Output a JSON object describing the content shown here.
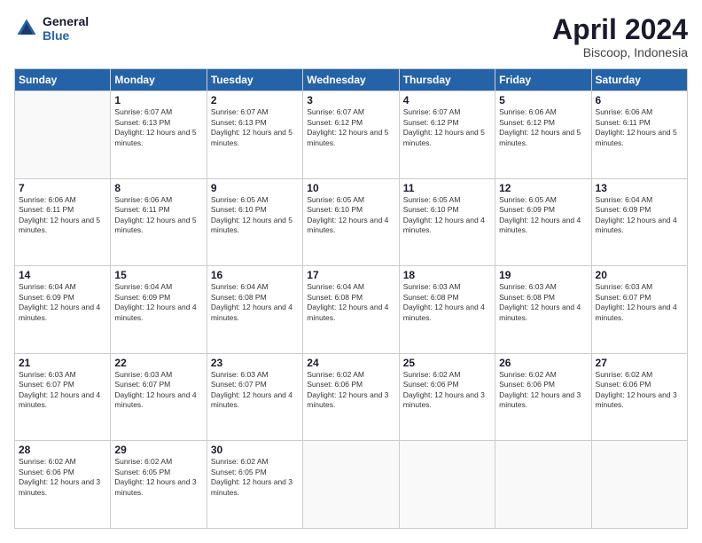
{
  "logo": {
    "line1": "General",
    "line2": "Blue"
  },
  "title": "April 2024",
  "subtitle": "Biscoop, Indonesia",
  "days_header": [
    "Sunday",
    "Monday",
    "Tuesday",
    "Wednesday",
    "Thursday",
    "Friday",
    "Saturday"
  ],
  "weeks": [
    [
      {
        "day": "",
        "sunrise": "",
        "sunset": "",
        "daylight": ""
      },
      {
        "day": "1",
        "sunrise": "Sunrise: 6:07 AM",
        "sunset": "Sunset: 6:13 PM",
        "daylight": "Daylight: 12 hours and 5 minutes."
      },
      {
        "day": "2",
        "sunrise": "Sunrise: 6:07 AM",
        "sunset": "Sunset: 6:13 PM",
        "daylight": "Daylight: 12 hours and 5 minutes."
      },
      {
        "day": "3",
        "sunrise": "Sunrise: 6:07 AM",
        "sunset": "Sunset: 6:12 PM",
        "daylight": "Daylight: 12 hours and 5 minutes."
      },
      {
        "day": "4",
        "sunrise": "Sunrise: 6:07 AM",
        "sunset": "Sunset: 6:12 PM",
        "daylight": "Daylight: 12 hours and 5 minutes."
      },
      {
        "day": "5",
        "sunrise": "Sunrise: 6:06 AM",
        "sunset": "Sunset: 6:12 PM",
        "daylight": "Daylight: 12 hours and 5 minutes."
      },
      {
        "day": "6",
        "sunrise": "Sunrise: 6:06 AM",
        "sunset": "Sunset: 6:11 PM",
        "daylight": "Daylight: 12 hours and 5 minutes."
      }
    ],
    [
      {
        "day": "7",
        "sunrise": "Sunrise: 6:06 AM",
        "sunset": "Sunset: 6:11 PM",
        "daylight": "Daylight: 12 hours and 5 minutes."
      },
      {
        "day": "8",
        "sunrise": "Sunrise: 6:06 AM",
        "sunset": "Sunset: 6:11 PM",
        "daylight": "Daylight: 12 hours and 5 minutes."
      },
      {
        "day": "9",
        "sunrise": "Sunrise: 6:05 AM",
        "sunset": "Sunset: 6:10 PM",
        "daylight": "Daylight: 12 hours and 5 minutes."
      },
      {
        "day": "10",
        "sunrise": "Sunrise: 6:05 AM",
        "sunset": "Sunset: 6:10 PM",
        "daylight": "Daylight: 12 hours and 4 minutes."
      },
      {
        "day": "11",
        "sunrise": "Sunrise: 6:05 AM",
        "sunset": "Sunset: 6:10 PM",
        "daylight": "Daylight: 12 hours and 4 minutes."
      },
      {
        "day": "12",
        "sunrise": "Sunrise: 6:05 AM",
        "sunset": "Sunset: 6:09 PM",
        "daylight": "Daylight: 12 hours and 4 minutes."
      },
      {
        "day": "13",
        "sunrise": "Sunrise: 6:04 AM",
        "sunset": "Sunset: 6:09 PM",
        "daylight": "Daylight: 12 hours and 4 minutes."
      }
    ],
    [
      {
        "day": "14",
        "sunrise": "Sunrise: 6:04 AM",
        "sunset": "Sunset: 6:09 PM",
        "daylight": "Daylight: 12 hours and 4 minutes."
      },
      {
        "day": "15",
        "sunrise": "Sunrise: 6:04 AM",
        "sunset": "Sunset: 6:09 PM",
        "daylight": "Daylight: 12 hours and 4 minutes."
      },
      {
        "day": "16",
        "sunrise": "Sunrise: 6:04 AM",
        "sunset": "Sunset: 6:08 PM",
        "daylight": "Daylight: 12 hours and 4 minutes."
      },
      {
        "day": "17",
        "sunrise": "Sunrise: 6:04 AM",
        "sunset": "Sunset: 6:08 PM",
        "daylight": "Daylight: 12 hours and 4 minutes."
      },
      {
        "day": "18",
        "sunrise": "Sunrise: 6:03 AM",
        "sunset": "Sunset: 6:08 PM",
        "daylight": "Daylight: 12 hours and 4 minutes."
      },
      {
        "day": "19",
        "sunrise": "Sunrise: 6:03 AM",
        "sunset": "Sunset: 6:08 PM",
        "daylight": "Daylight: 12 hours and 4 minutes."
      },
      {
        "day": "20",
        "sunrise": "Sunrise: 6:03 AM",
        "sunset": "Sunset: 6:07 PM",
        "daylight": "Daylight: 12 hours and 4 minutes."
      }
    ],
    [
      {
        "day": "21",
        "sunrise": "Sunrise: 6:03 AM",
        "sunset": "Sunset: 6:07 PM",
        "daylight": "Daylight: 12 hours and 4 minutes."
      },
      {
        "day": "22",
        "sunrise": "Sunrise: 6:03 AM",
        "sunset": "Sunset: 6:07 PM",
        "daylight": "Daylight: 12 hours and 4 minutes."
      },
      {
        "day": "23",
        "sunrise": "Sunrise: 6:03 AM",
        "sunset": "Sunset: 6:07 PM",
        "daylight": "Daylight: 12 hours and 4 minutes."
      },
      {
        "day": "24",
        "sunrise": "Sunrise: 6:02 AM",
        "sunset": "Sunset: 6:06 PM",
        "daylight": "Daylight: 12 hours and 3 minutes."
      },
      {
        "day": "25",
        "sunrise": "Sunrise: 6:02 AM",
        "sunset": "Sunset: 6:06 PM",
        "daylight": "Daylight: 12 hours and 3 minutes."
      },
      {
        "day": "26",
        "sunrise": "Sunrise: 6:02 AM",
        "sunset": "Sunset: 6:06 PM",
        "daylight": "Daylight: 12 hours and 3 minutes."
      },
      {
        "day": "27",
        "sunrise": "Sunrise: 6:02 AM",
        "sunset": "Sunset: 6:06 PM",
        "daylight": "Daylight: 12 hours and 3 minutes."
      }
    ],
    [
      {
        "day": "28",
        "sunrise": "Sunrise: 6:02 AM",
        "sunset": "Sunset: 6:06 PM",
        "daylight": "Daylight: 12 hours and 3 minutes."
      },
      {
        "day": "29",
        "sunrise": "Sunrise: 6:02 AM",
        "sunset": "Sunset: 6:05 PM",
        "daylight": "Daylight: 12 hours and 3 minutes."
      },
      {
        "day": "30",
        "sunrise": "Sunrise: 6:02 AM",
        "sunset": "Sunset: 6:05 PM",
        "daylight": "Daylight: 12 hours and 3 minutes."
      },
      {
        "day": "",
        "sunrise": "",
        "sunset": "",
        "daylight": ""
      },
      {
        "day": "",
        "sunrise": "",
        "sunset": "",
        "daylight": ""
      },
      {
        "day": "",
        "sunrise": "",
        "sunset": "",
        "daylight": ""
      },
      {
        "day": "",
        "sunrise": "",
        "sunset": "",
        "daylight": ""
      }
    ]
  ]
}
